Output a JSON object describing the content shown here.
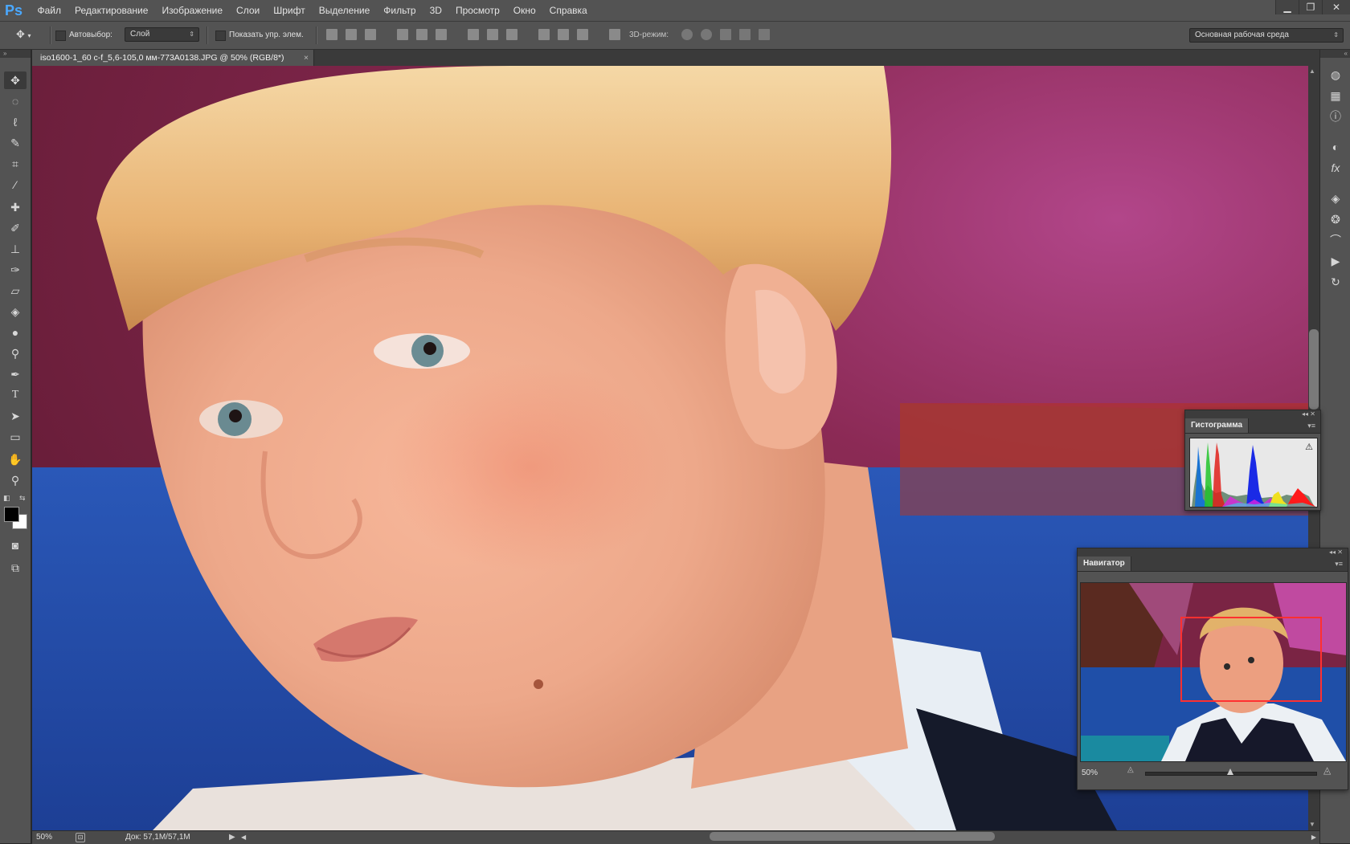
{
  "app": {
    "logo": "Ps"
  },
  "menu": {
    "items": [
      "Файл",
      "Редактирование",
      "Изображение",
      "Слои",
      "Шрифт",
      "Выделение",
      "Фильтр",
      "3D",
      "Просмотр",
      "Окно",
      "Справка"
    ]
  },
  "window_buttons": {
    "minimize": "▁",
    "restore": "❐",
    "close": "✕"
  },
  "options": {
    "autoselect_label": "Автовыбор:",
    "autoselect_target": "Слой",
    "show_transform_label": "Показать упр. элем.",
    "mode_3d_label": "3D-режим:",
    "workspace": "Основная рабочая среда"
  },
  "document": {
    "tab_title": "iso1600-1_60 c-f_5,6-105,0 мм-773A0138.JPG @ 50% (RGB/8*)",
    "close": "×"
  },
  "status": {
    "zoom": "50%",
    "doc_info": "Док: 57,1M/57,1M"
  },
  "histogram": {
    "title": "Гистограмма",
    "warning_icon": "warning-icon"
  },
  "navigator": {
    "title": "Навигатор",
    "zoom": "50%",
    "zoom_level": 0.5
  },
  "colors": {
    "panel": "#535353",
    "dark": "#282828",
    "foreground": "#000000",
    "background": "#ffffff",
    "accent": "#4aa8ff"
  }
}
